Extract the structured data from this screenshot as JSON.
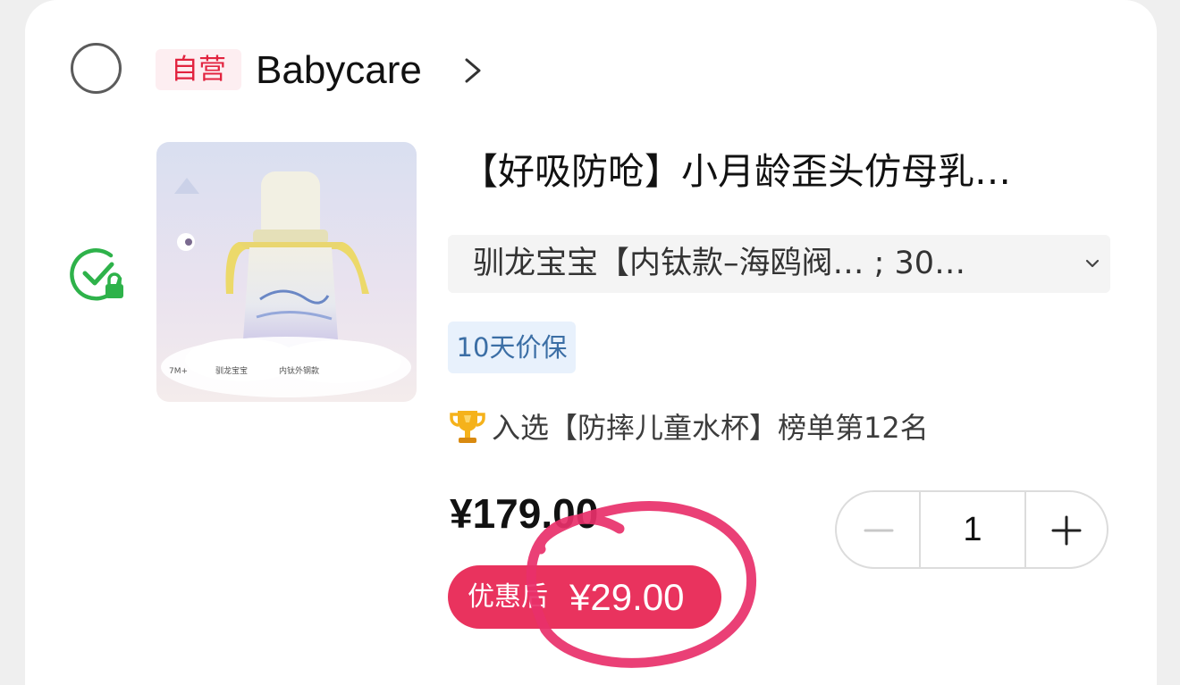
{
  "shop": {
    "badge": "自营",
    "name": "Babycare"
  },
  "product": {
    "title": "【好吸防呛】小月龄歪头仿母乳…",
    "spec": "驯龙宝宝【内钛款–海鸥阀… ; 30…",
    "price_protection": "10天价保",
    "ranking": "入选【防摔儿童水杯】榜单第12名",
    "price": "¥179.00",
    "discount_label": "优惠后",
    "discount_price": "¥29.00",
    "quantity": "1",
    "image_labels": [
      "7M+",
      "驯龙宝宝",
      "内钛外钢款"
    ]
  },
  "colors": {
    "accent": "#e9335e",
    "badge_text": "#e2233f",
    "badge_bg": "#fdeef1",
    "protect_bg": "#e8f1fc",
    "protect_text": "#3b6ea5",
    "check_green": "#2eb24a",
    "annotation_circle": "#e8306a"
  },
  "icons": {
    "select": "radio-circle-icon",
    "arrow": "chevron-right-icon",
    "lock": "locked-check-icon",
    "dropdown": "chevron-down-icon",
    "trophy": "trophy-icon",
    "minus": "minus-icon",
    "plus": "plus-icon"
  }
}
